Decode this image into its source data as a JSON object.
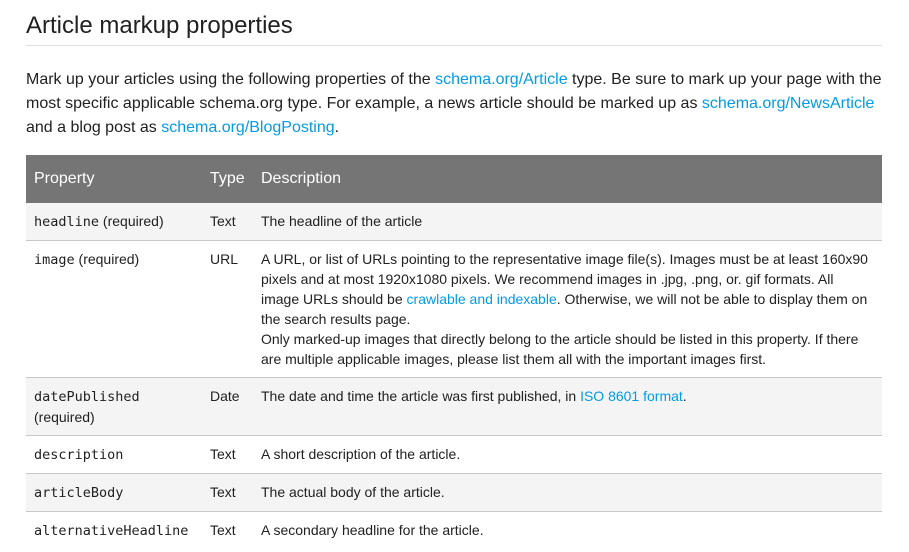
{
  "title": "Article markup properties",
  "intro": {
    "text1": "Mark up your articles using the following properties of the ",
    "link1": "schema.org/Article",
    "text2": " type. Be sure to mark up your page with the most specific applicable schema.org type. For example, a news article should be marked up as ",
    "link2": "schema.org/NewsArticle",
    "text3": " and a blog post as ",
    "link3": "schema.org/BlogPosting",
    "text4": "."
  },
  "table": {
    "headers": {
      "property": "Property",
      "type": "Type",
      "description": "Description"
    },
    "rows": [
      {
        "property": "headline",
        "required": " (required)",
        "type": "Text",
        "desc": "The headline of the article"
      },
      {
        "property": "image",
        "required": " (required)",
        "type": "URL",
        "desc_a": "A URL, or list of URLs pointing to the representative image file(s). Images must be at least 160x90 pixels and at most 1920x1080 pixels. We recommend images in .jpg, .png, or. gif formats. All image URLs should be ",
        "desc_link": "crawlable and indexable",
        "desc_b": ". Otherwise, we will not be able to display them on the search results page.",
        "desc_c": "Only marked-up images that directly belong to the article should be listed in this property. If there are multiple applicable images, please list them all with the important images first."
      },
      {
        "property": "datePublished",
        "required": "(required)",
        "type": "Date",
        "desc_a": "The date and time the article was first published, in ",
        "desc_link": "ISO 8601 format",
        "desc_b": "."
      },
      {
        "property": "description",
        "type": "Text",
        "desc": "A short description of the article."
      },
      {
        "property": "articleBody",
        "type": "Text",
        "desc": "The actual body of the article."
      },
      {
        "property": "alternativeHeadline",
        "type": "Text",
        "desc": "A secondary headline for the article."
      }
    ]
  },
  "colors": {
    "link": "#039be5",
    "header_bg": "#757575",
    "alt_row_bg": "#f4f4f4"
  }
}
